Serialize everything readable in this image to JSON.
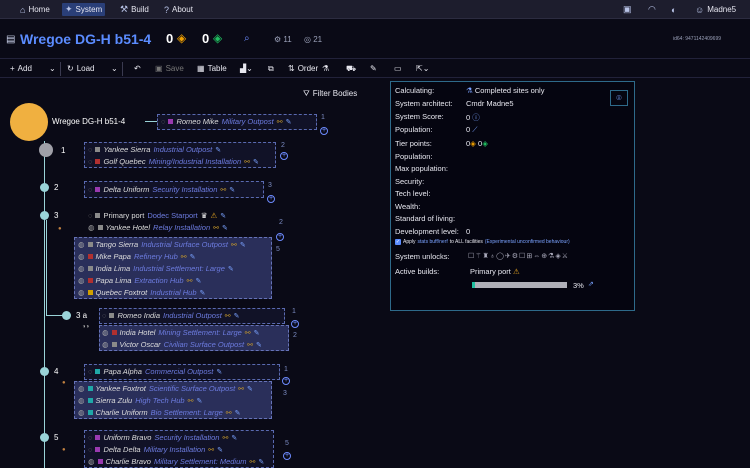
{
  "nav": {
    "home": "Home",
    "system": "System",
    "build": "Build",
    "about": "About",
    "user": "Madne5"
  },
  "header": {
    "system_name": "Wregoe DG-H b51-4",
    "tier2_points": "0",
    "tier3_points": "0",
    "count_a": "11",
    "count_b": "21",
    "id_text": "id64: 9471142409699"
  },
  "toolbar": {
    "add": "Add",
    "load": "Load",
    "save": "Save",
    "table": "Table",
    "order": "Order"
  },
  "filter_label": "Filter Bodies",
  "tree": {
    "star": "Wregoe DG-H b51-4",
    "star_site": {
      "name": "Romeo Mike",
      "type": "Military Outpost",
      "color": "#9a3ab0"
    },
    "star_count": "1",
    "bodies": [
      {
        "label": "1",
        "count": "2",
        "sites": [
          {
            "name": "Yankee Sierra",
            "type": "Industrial Outpost",
            "color": "#8a8a8a"
          },
          {
            "name": "Golf Quebec",
            "type": "Mining/Industrial Installation",
            "color": "#b03030"
          }
        ]
      },
      {
        "label": "2",
        "count": "3",
        "sites": [
          {
            "name": "Delta Uniform",
            "type": "Security Installation",
            "color": "#9a3ab0"
          }
        ]
      },
      {
        "label": "3",
        "count_a": "2",
        "count_b": "5",
        "sites": [
          {
            "name": "Primary port",
            "type": "Dodec Starport",
            "color": "#8a8a8a"
          },
          {
            "name": "Yankee Hotel",
            "type": "Relay Installation",
            "color": "#8a8a8a"
          },
          {
            "name": "Tango Sierra",
            "type": "Industrial Surface Outpost",
            "color": "#8a8a8a"
          },
          {
            "name": "Mike Papa",
            "type": "Refinery Hub",
            "color": "#b03030"
          },
          {
            "name": "India Lima",
            "type": "Industrial Settlement: Large",
            "color": "#8a8a8a"
          },
          {
            "name": "Papa Lima",
            "type": "Extraction Hub",
            "color": "#b03030"
          },
          {
            "name": "Quebec Foxtrot",
            "type": "Industrial Hub",
            "color": "#d0a000"
          }
        ]
      },
      {
        "label": "3 a",
        "count_a": "1",
        "count_b": "2",
        "sites": [
          {
            "name": "Romeo India",
            "type": "Industrial Outpost",
            "color": "#8a8a8a"
          },
          {
            "name": "India Hotel",
            "type": "Mining Settlement: Large",
            "color": "#b03030"
          },
          {
            "name": "Victor Oscar",
            "type": "Civilian Surface Outpost",
            "color": "#8a8a8a"
          }
        ]
      },
      {
        "label": "4",
        "count_a": "1",
        "count_b": "3",
        "sites": [
          {
            "name": "Papa Alpha",
            "type": "Commercial Outpost",
            "color": "#20a8a8"
          },
          {
            "name": "Yankee Foxtrot",
            "type": "Scientific Surface Outpost",
            "color": "#20a8a8"
          },
          {
            "name": "Sierra Zulu",
            "type": "High Tech Hub",
            "color": "#20a8a8"
          },
          {
            "name": "Charlie Uniform",
            "type": "Bio Settlement: Large",
            "color": "#20a8a8"
          }
        ]
      },
      {
        "label": "5",
        "count": "5",
        "sites": [
          {
            "name": "Uniform Bravo",
            "type": "Security Installation",
            "color": "#9a3ab0"
          },
          {
            "name": "Delta Delta",
            "type": "Military Installation",
            "color": "#9a3ab0"
          },
          {
            "name": "Charlie Bravo",
            "type": "Military Settlement: Medium",
            "color": "#9a3ab0"
          }
        ]
      }
    ]
  },
  "panel": {
    "calculating_label": "Calculating:",
    "calculating_value": "Completed sites only",
    "architect_label": "System architect:",
    "architect_value": "Cmdr Madne5",
    "score_label": "System Score:",
    "score_value": "0",
    "population_label": "Population:",
    "population_value": "0",
    "tier_label": "Tier points:",
    "tier_a": "0",
    "tier_b": "0",
    "population2_label": "Population:",
    "maxpop_label": "Max population:",
    "security_label": "Security:",
    "tech_label": "Tech level:",
    "wealth_label": "Wealth:",
    "standard_label": "Standard of living:",
    "development_label": "Development level:",
    "development_value": "0",
    "apply_text_a": "Apply",
    "apply_link": "stats buff/nerf",
    "apply_text_b": "to ALL facilities",
    "apply_note": "(Experimental unconfirmed behaviour)",
    "unlocks_label": "System unlocks:",
    "active_label": "Active builds:",
    "active_value": "Primary port",
    "progress_text": "3%",
    "progress_value": 0.03,
    "accent": "#20c0a0"
  }
}
